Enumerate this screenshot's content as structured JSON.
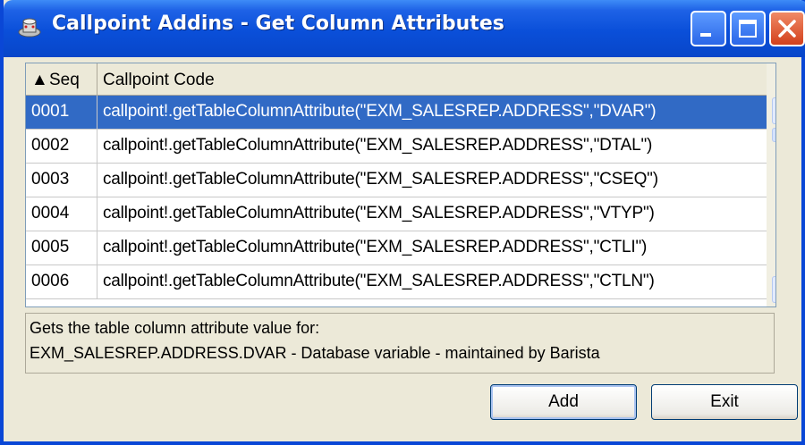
{
  "window": {
    "title": "Callpoint Addins - Get Column Attributes"
  },
  "grid": {
    "columns": [
      {
        "label": "Seq",
        "sort": "ascending"
      },
      {
        "label": "Callpoint Code"
      }
    ],
    "rows": [
      {
        "seq": "0001",
        "code": "callpoint!.getTableColumnAttribute(\"EXM_SALESREP.ADDRESS\",\"DVAR\")",
        "selected": true
      },
      {
        "seq": "0002",
        "code": "callpoint!.getTableColumnAttribute(\"EXM_SALESREP.ADDRESS\",\"DTAL\")"
      },
      {
        "seq": "0003",
        "code": "callpoint!.getTableColumnAttribute(\"EXM_SALESREP.ADDRESS\",\"CSEQ\")"
      },
      {
        "seq": "0004",
        "code": "callpoint!.getTableColumnAttribute(\"EXM_SALESREP.ADDRESS\",\"VTYP\")"
      },
      {
        "seq": "0005",
        "code": "callpoint!.getTableColumnAttribute(\"EXM_SALESREP.ADDRESS\",\"CTLI\")"
      },
      {
        "seq": "0006",
        "code": "callpoint!.getTableColumnAttribute(\"EXM_SALESREP.ADDRESS\",\"CTLN\")"
      }
    ]
  },
  "description": {
    "line1": "Gets the table column attribute value for:",
    "line2": "EXM_SALESREP.ADDRESS.DVAR - Database variable - maintained by Barista"
  },
  "buttons": {
    "add": "Add",
    "exit": "Exit"
  },
  "colors": {
    "titlebar": "#0A4FD9",
    "selection": "#316AC5",
    "dialog": "#ECE9D8"
  }
}
